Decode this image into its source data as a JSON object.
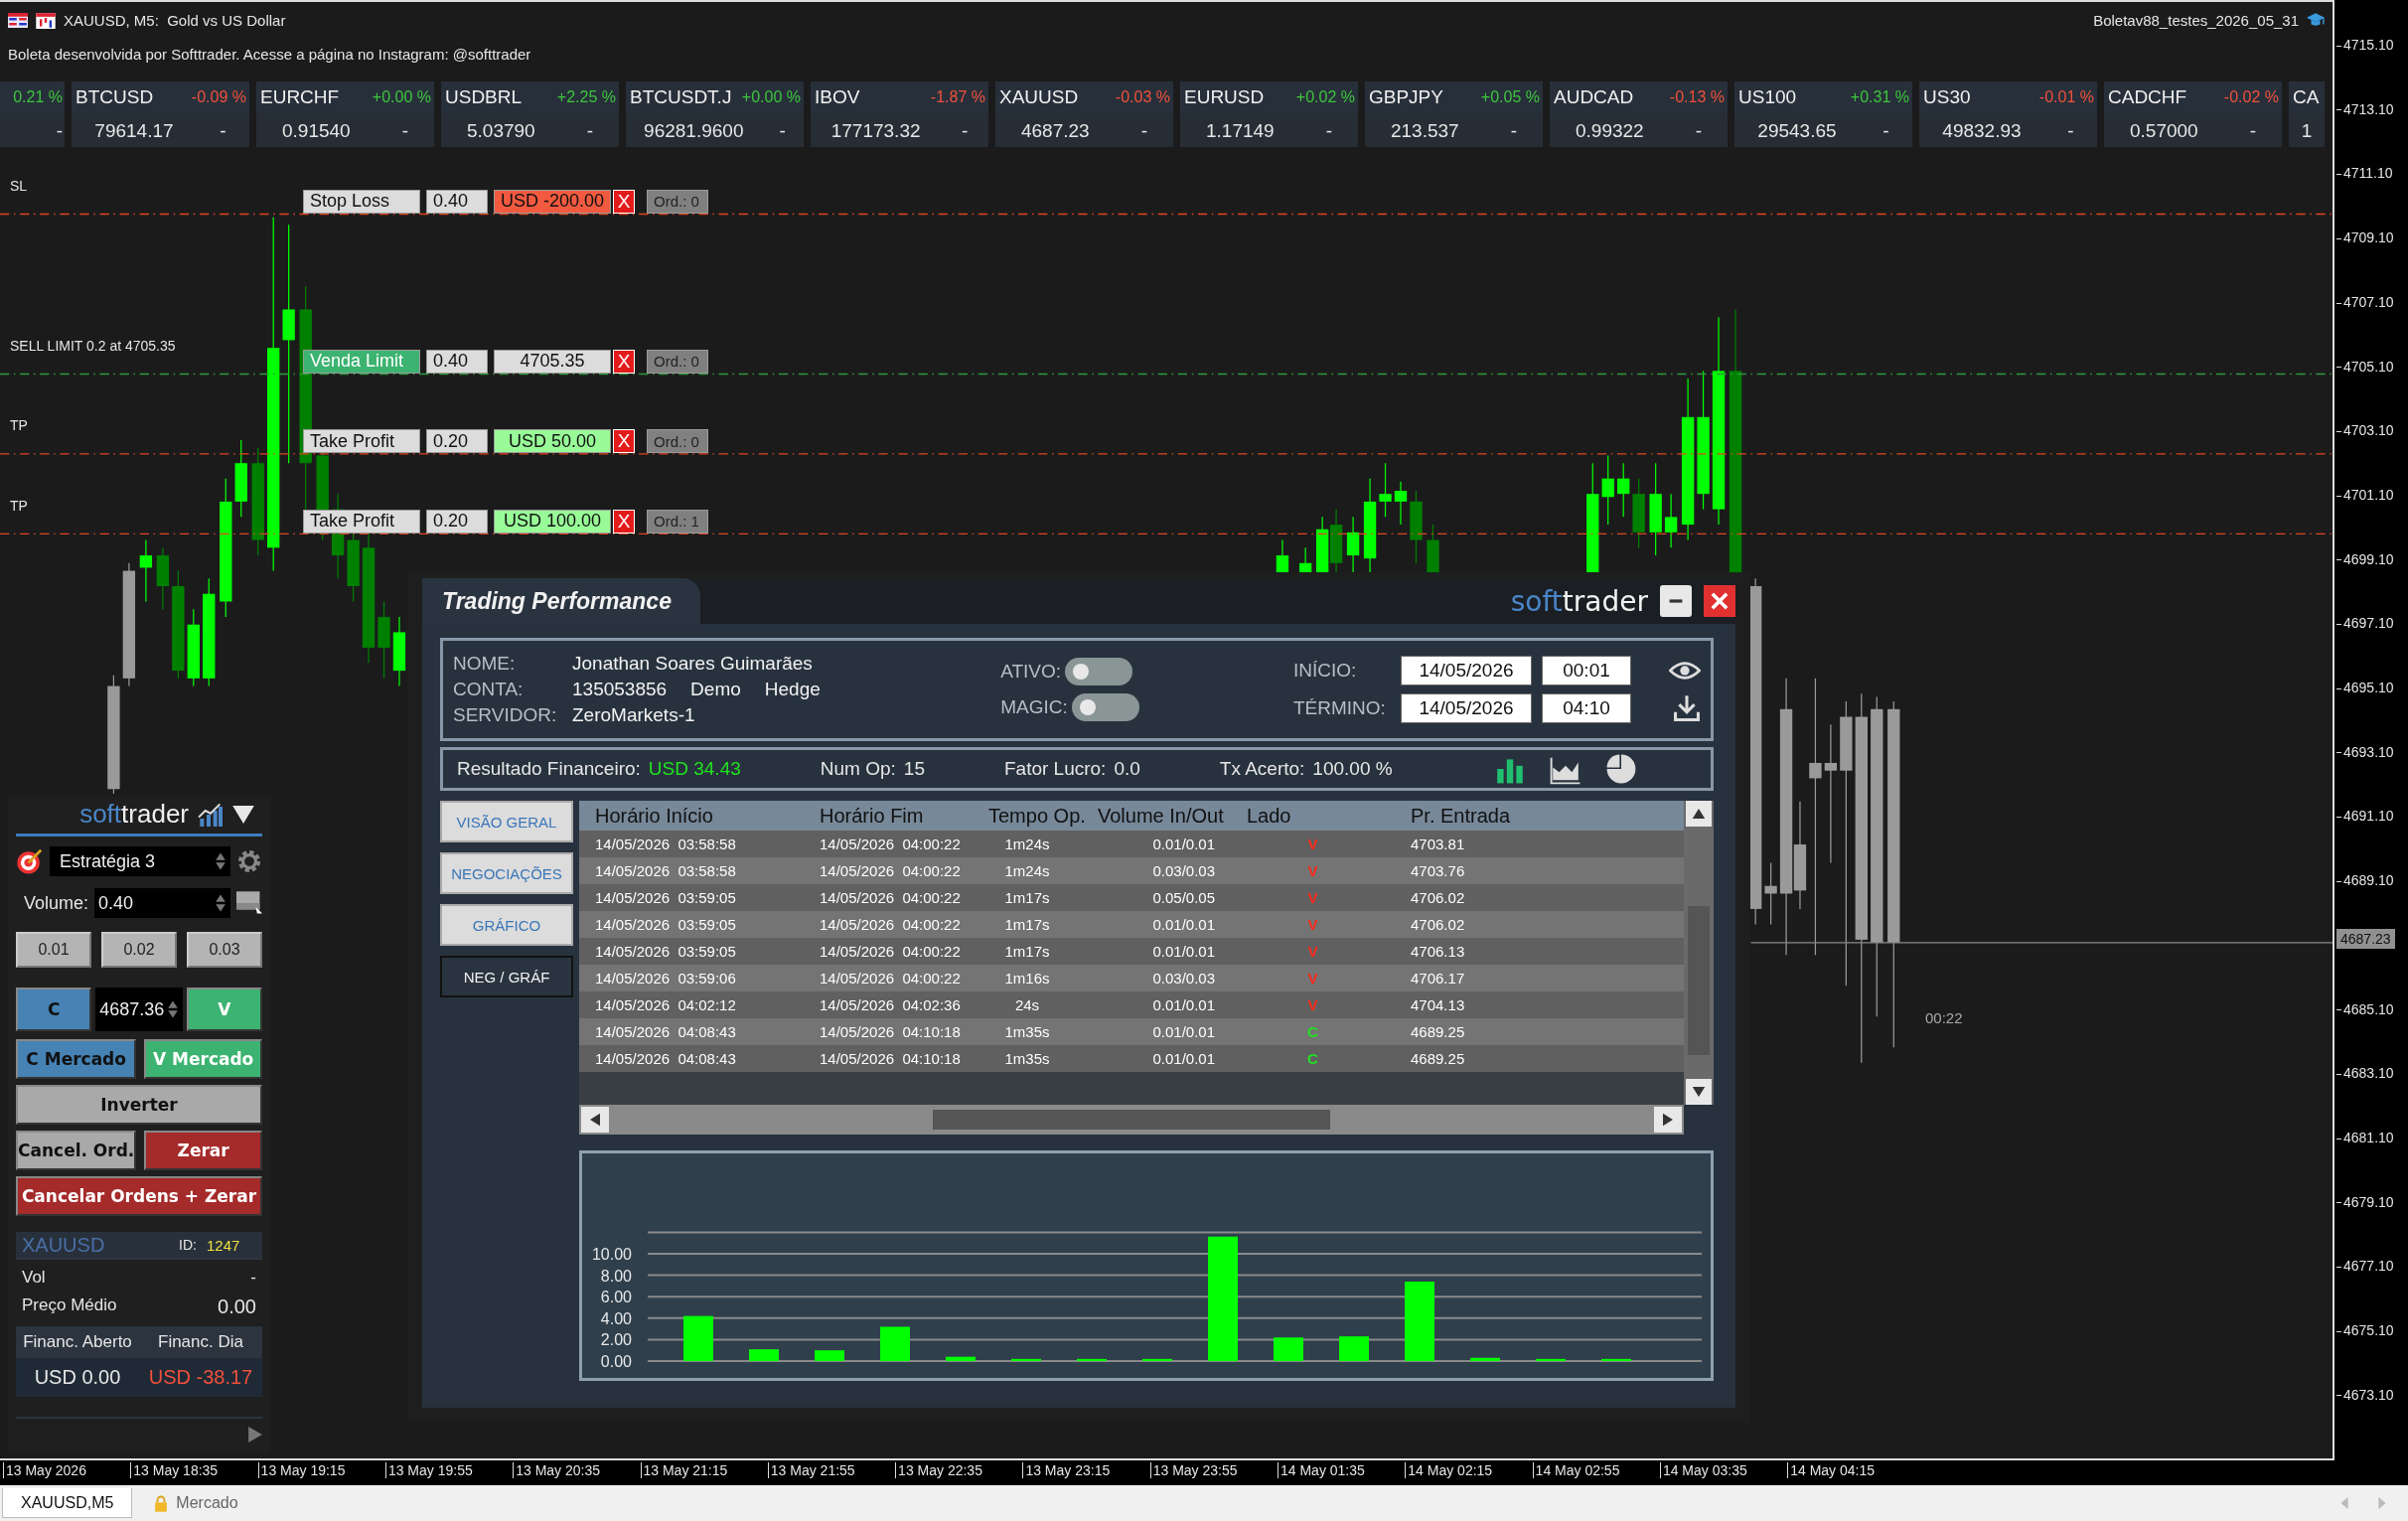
{
  "window": {
    "title": "XAUUSD, M5:  Gold vs US Dollar",
    "profile": "Boletav88_testes_2026_05_31"
  },
  "banner": "Boleta desenvolvida por Softtrader. Acesse a página no Instagram: @softtrader",
  "tickers": [
    {
      "change": "0.21 %",
      "color": "#3ec43e",
      "price": "-"
    },
    {
      "symbol": "BTCUSD",
      "change": "-0.09 %",
      "color": "#f0503c",
      "price": "79614.17",
      "extra": "-"
    },
    {
      "symbol": "EURCHF",
      "change": "+0.00 %",
      "color": "#3ec43e",
      "price": "0.91540",
      "extra": "-"
    },
    {
      "symbol": "USDBRL",
      "change": "+2.25 %",
      "color": "#3ec43e",
      "price": "5.03790",
      "extra": "-"
    },
    {
      "symbol": "BTCUSDT.J",
      "change": "+0.00 %",
      "color": "#3ec43e",
      "price": "96281.9600",
      "extra": "-"
    },
    {
      "symbol": "IBOV",
      "change": "-1.87 %",
      "color": "#f0503c",
      "price": "177173.32",
      "extra": "-"
    },
    {
      "symbol": "XAUUSD",
      "change": "-0.03 %",
      "color": "#f0503c",
      "price": "4687.23",
      "extra": "-"
    },
    {
      "symbol": "EURUSD",
      "change": "+0.02 %",
      "color": "#3ec43e",
      "price": "1.17149",
      "extra": "-"
    },
    {
      "symbol": "GBPJPY",
      "change": "+0.05 %",
      "color": "#3ec43e",
      "price": "213.537",
      "extra": "-"
    },
    {
      "symbol": "AUDCAD",
      "change": "-0.13 %",
      "color": "#f0503c",
      "price": "0.99322",
      "extra": "-"
    },
    {
      "symbol": "US100",
      "change": "+0.31 %",
      "color": "#3ec43e",
      "price": "29543.65",
      "extra": "-"
    },
    {
      "symbol": "US30",
      "change": "-0.01 %",
      "color": "#f0503c",
      "price": "49832.93",
      "extra": "-"
    },
    {
      "symbol": "CADCHF",
      "change": "-0.02 %",
      "color": "#f0503c",
      "price": "0.57000",
      "extra": "-"
    },
    {
      "symbol": "CA",
      "price": "1"
    }
  ],
  "order_lines": [
    {
      "kind": "sl",
      "line_label": "SL",
      "label": "Stop Loss",
      "volume": "0.40",
      "value": "USD -200.00",
      "close": "X",
      "orders": "Ord.: 0"
    },
    {
      "kind": "limit",
      "line_label": "SELL LIMIT 0.2 at 4705.35",
      "label": "Venda Limit",
      "volume": "0.40",
      "value": "4705.35",
      "close": "X",
      "orders": "Ord.: 0"
    },
    {
      "kind": "tp",
      "line_label": "TP",
      "label": "Take Profit",
      "volume": "0.20",
      "value": "USD 50.00",
      "close": "X",
      "orders": "Ord.: 0"
    },
    {
      "kind": "tp",
      "line_label": "TP",
      "label": "Take Profit",
      "volume": "0.20",
      "value": "USD 100.00",
      "close": "X",
      "orders": "Ord.: 1"
    }
  ],
  "price_axis": [
    "4715.10",
    "4713.10",
    "4711.10",
    "4709.10",
    "4707.10",
    "4705.10",
    "4703.10",
    "4701.10",
    "4699.10",
    "4697.10",
    "4695.10",
    "4693.10",
    "4691.10",
    "4689.10",
    "4685.10",
    "4683.10",
    "4681.10",
    "4679.10",
    "4677.10",
    "4675.10",
    "4673.10"
  ],
  "current_price": "4687.23",
  "countdown": "00:22",
  "time_axis": [
    "13 May 2026",
    "13 May 18:35",
    "13 May 19:15",
    "13 May 19:55",
    "13 May 20:35",
    "13 May 21:15",
    "13 May 21:55",
    "13 May 22:35",
    "13 May 23:15",
    "13 May 23:55",
    "14 May 01:35",
    "14 May 02:15",
    "14 May 02:55",
    "14 May 03:35",
    "14 May 04:15"
  ],
  "panel": {
    "logo_parts": [
      "soft",
      "trader"
    ],
    "strategy": "Estratégia 3",
    "volume_label": "Volume:",
    "volume": "0.40",
    "quick_volumes": [
      "0.01",
      "0.02",
      "0.03"
    ],
    "buy_label": "C",
    "price": "4687.36",
    "sell_label": "V",
    "buttons": [
      {
        "kind": "buy",
        "label": "C Mercado"
      },
      {
        "kind": "sell",
        "label": "V Mercado"
      },
      {
        "kind": "neutral",
        "label": "Inverter"
      },
      {
        "kind": "neutral",
        "label": "Cancel. Ord."
      },
      {
        "kind": "danger",
        "label": "Zerar"
      },
      {
        "kind": "danger",
        "label": "Cancelar Ordens + Zerar"
      }
    ],
    "symbol": "XAUUSD",
    "id_label": "ID:",
    "id": "1247",
    "vol_label": "Vol",
    "vol": "-",
    "avg_label": "Preço Médio",
    "avg": "0.00",
    "open_label": "Financ. Aberto",
    "day_label": "Financ. Dia",
    "open_value": "USD 0.00",
    "day_value": "USD -38.17"
  },
  "dialog": {
    "title": "Trading Performance",
    "logo_parts": [
      "soft",
      "trader"
    ],
    "info": {
      "name_label": "NOME:",
      "name": "Jonathan Soares Guimarães",
      "account_label": "CONTA:",
      "account": "135053856",
      "account_type": "Demo",
      "margin_mode": "Hedge",
      "server_label": "SERVIDOR:",
      "server": "ZeroMarkets-1"
    },
    "toggles": [
      {
        "label": "ATIVO:",
        "on": false
      },
      {
        "label": "MAGIC:",
        "on": false
      }
    ],
    "start_label": "INÍCIO:",
    "start_date": "14/05/2026",
    "start_time": "00:01",
    "end_label": "TÉRMINO:",
    "end_date": "14/05/2026",
    "end_time": "04:10",
    "stats": [
      {
        "label": "Resultado Financeiro:",
        "value": "USD 34.43",
        "kind": "positive"
      },
      {
        "label": "Num Op:",
        "value": "15",
        "kind": "plain"
      },
      {
        "label": "Fator Lucro:",
        "value": "0.0",
        "kind": "plain"
      },
      {
        "label": "Tx Acerto:",
        "value": "100.00 %",
        "kind": "plain"
      }
    ],
    "side_tabs": [
      {
        "label": "VISÃO GERAL",
        "selected": false
      },
      {
        "label": "NEGOCIAÇÕES",
        "selected": false
      },
      {
        "label": "GRÁFICO",
        "selected": false
      },
      {
        "label": "NEG / GRÁF",
        "selected": true
      }
    ],
    "columns": [
      "Horário Início",
      "Horário Fim",
      "Tempo Op.",
      "Volume In/Out",
      "Lado",
      "Pr. Entrada"
    ],
    "rows": [
      {
        "start": "14/05/2026  03:58:58",
        "end": "14/05/2026  04:00:22",
        "duration": "1m24s",
        "volume": "0.01/0.01",
        "side": "V",
        "color": "#ff2a1a",
        "entry": "4703.81"
      },
      {
        "start": "14/05/2026  03:58:58",
        "end": "14/05/2026  04:00:22",
        "duration": "1m24s",
        "volume": "0.03/0.03",
        "side": "V",
        "color": "#ff2a1a",
        "entry": "4703.76"
      },
      {
        "start": "14/05/2026  03:59:05",
        "end": "14/05/2026  04:00:22",
        "duration": "1m17s",
        "volume": "0.05/0.05",
        "side": "V",
        "color": "#ff2a1a",
        "entry": "4706.02"
      },
      {
        "start": "14/05/2026  03:59:05",
        "end": "14/05/2026  04:00:22",
        "duration": "1m17s",
        "volume": "0.01/0.01",
        "side": "V",
        "color": "#ff2a1a",
        "entry": "4706.02"
      },
      {
        "start": "14/05/2026  03:59:05",
        "end": "14/05/2026  04:00:22",
        "duration": "1m17s",
        "volume": "0.01/0.01",
        "side": "V",
        "color": "#ff2a1a",
        "entry": "4706.13"
      },
      {
        "start": "14/05/2026  03:59:06",
        "end": "14/05/2026  04:00:22",
        "duration": "1m16s",
        "volume": "0.03/0.03",
        "side": "V",
        "color": "#ff2a1a",
        "entry": "4706.17"
      },
      {
        "start": "14/05/2026  04:02:12",
        "end": "14/05/2026  04:02:36",
        "duration": "24s",
        "volume": "0.01/0.01",
        "side": "V",
        "color": "#ff2a1a",
        "entry": "4704.13"
      },
      {
        "start": "14/05/2026  04:08:43",
        "end": "14/05/2026  04:10:18",
        "duration": "1m35s",
        "volume": "0.01/0.01",
        "side": "C",
        "color": "#22e022",
        "entry": "4689.25"
      },
      {
        "start": "14/05/2026  04:08:43",
        "end": "14/05/2026  04:10:18",
        "duration": "1m35s",
        "volume": "0.01/0.01",
        "side": "C",
        "color": "#22e022",
        "entry": "4689.25"
      }
    ],
    "chart_data": {
      "type": "bar",
      "grid": true,
      "ylim": [
        0,
        12
      ],
      "series": [
        {
          "color": "#00ff00",
          "values": [
            4.2,
            1.1,
            1.0,
            3.2,
            0.4,
            0.2,
            0.2,
            0.2,
            11.6,
            2.2,
            2.3,
            7.4,
            0.3,
            0.2,
            0.2
          ]
        }
      ],
      "yticks": [
        {
          "value": 0,
          "label": "0.00"
        },
        {
          "value": 2,
          "label": "2.00"
        },
        {
          "value": 4,
          "label": "4.00"
        },
        {
          "value": 6,
          "label": "6.00"
        },
        {
          "value": 8,
          "label": "8.00"
        },
        {
          "value": 10,
          "label": "10.00"
        }
      ]
    }
  },
  "bottom_tabs": [
    {
      "label": "XAUUSD,M5",
      "selected": true,
      "kind": "chart"
    },
    {
      "label": "Mercado",
      "selected": false,
      "kind": "locked"
    }
  ]
}
